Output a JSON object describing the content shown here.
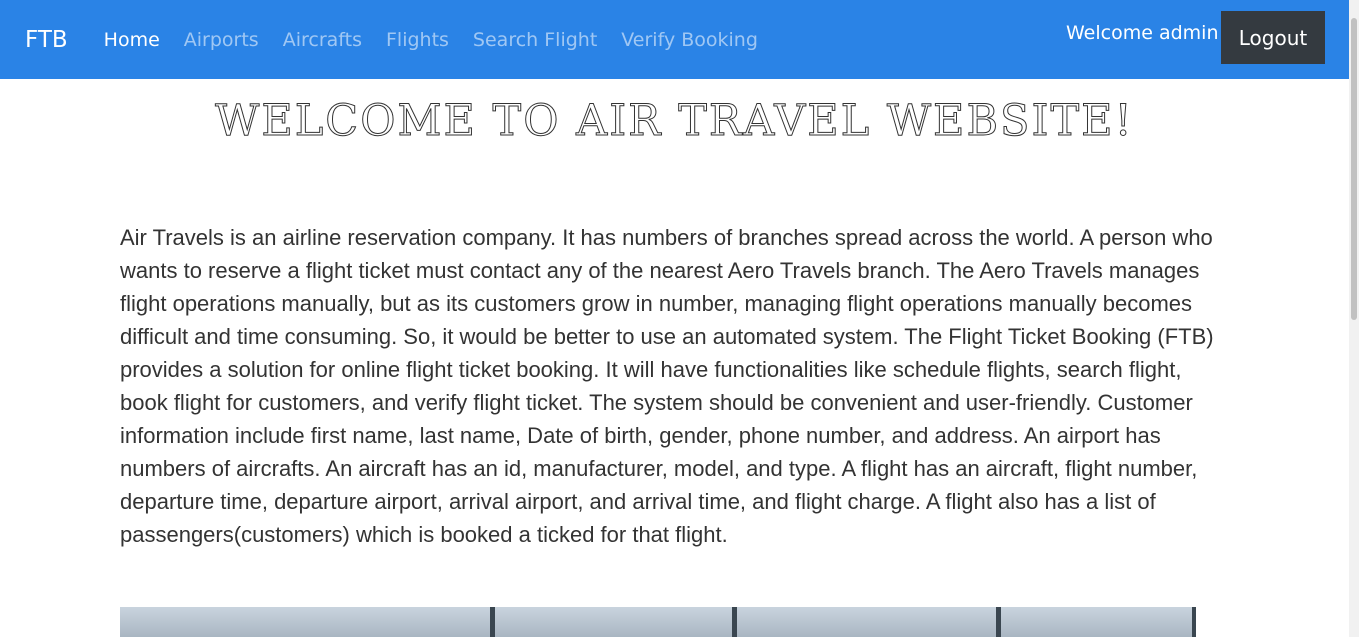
{
  "navbar": {
    "brand": "FTB",
    "links": [
      "Home",
      "Airports",
      "Aircrafts",
      "Flights",
      "Search Flight",
      "Verify Booking"
    ],
    "active_link": "Home",
    "welcome_text": "Welcome admin",
    "logout_label": "Logout"
  },
  "main": {
    "title": "WELCOME TO AIR TRAVEL WEBSITE!",
    "intro": "Air Travels is an airline reservation company. It has numbers of branches spread across the world. A person who wants to reserve a flight ticket must contact any of the nearest Aero Travels branch. The Aero Travels manages flight operations manually, but as its customers grow in number, managing flight operations manually becomes difficult and time consuming. So, it would be better to use an automated system. The Flight Ticket Booking (FTB) provides a solution for online flight ticket booking. It will have functionalities like schedule flights, search flight, book flight for customers, and verify flight ticket. The system should be convenient and user-friendly. Customer information include first name, last name, Date of birth, gender, phone number, and address. An airport has numbers of aircrafts. An aircraft has an id, manufacturer, model, and type. A flight has an aircraft, flight number, departure time, departure airport, arrival airport, and arrival time, and flight charge. A flight also has a list of passengers(customers) which is booked a ticked for that flight."
  },
  "colors": {
    "navbar": "#2a83e6",
    "logout_bg": "#343a40",
    "text": "#333333"
  }
}
